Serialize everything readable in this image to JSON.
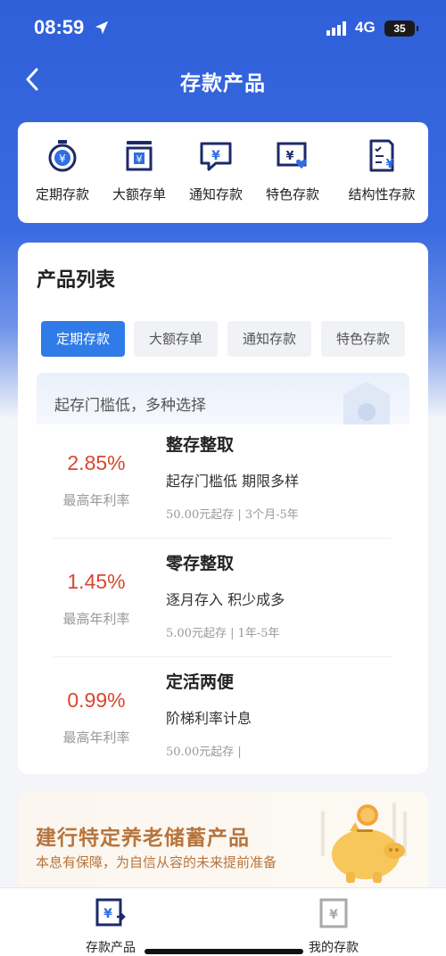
{
  "status_bar": {
    "time": "08:59",
    "network": "4G",
    "battery": "35"
  },
  "nav": {
    "title": "存款产品"
  },
  "categories": [
    {
      "label": "定期存款",
      "icon": "timer-yuan-icon"
    },
    {
      "label": "大额存单",
      "icon": "receipt-yuan-icon"
    },
    {
      "label": "通知存款",
      "icon": "message-yuan-icon"
    },
    {
      "label": "特色存款",
      "icon": "card-heart-yuan-icon"
    },
    {
      "label": "结构性存款",
      "icon": "document-yuan-icon"
    }
  ],
  "product_list": {
    "title": "产品列表",
    "tabs": [
      "定期存款",
      "大额存单",
      "通知存款",
      "特色存款"
    ],
    "active_tab": "定期存款",
    "banner": "起存门槛低，多种选择",
    "products": [
      {
        "rate": "2.85%",
        "rate_label": "最高年利率",
        "name": "整存整取",
        "desc": "起存门槛低  期限多样",
        "meta": "50.00元起存 | 3个月-5年"
      },
      {
        "rate": "1.45%",
        "rate_label": "最高年利率",
        "name": "零存整取",
        "desc": "逐月存入  积少成多",
        "meta": "5.00元起存 | 1年-5年"
      },
      {
        "rate": "0.99%",
        "rate_label": "最高年利率",
        "name": "定活两便",
        "desc": "阶梯利率计息",
        "meta": "50.00元起存 |"
      }
    ]
  },
  "promo": {
    "title": "建行特定养老储蓄产品",
    "subtitle": "本息有保障，为自信从容的未来提前准备"
  },
  "tabbar": [
    {
      "label": "存款产品",
      "icon": "deposit-product-icon",
      "active": true
    },
    {
      "label": "我的存款",
      "icon": "my-deposit-icon",
      "active": false
    }
  ],
  "colors": {
    "brand_blue": "#2f5fd9",
    "tab_active": "#2f7be8",
    "rate_red": "#d8472f",
    "promo_gold": "#b8743d",
    "icon_navy": "#1c2a6b"
  }
}
